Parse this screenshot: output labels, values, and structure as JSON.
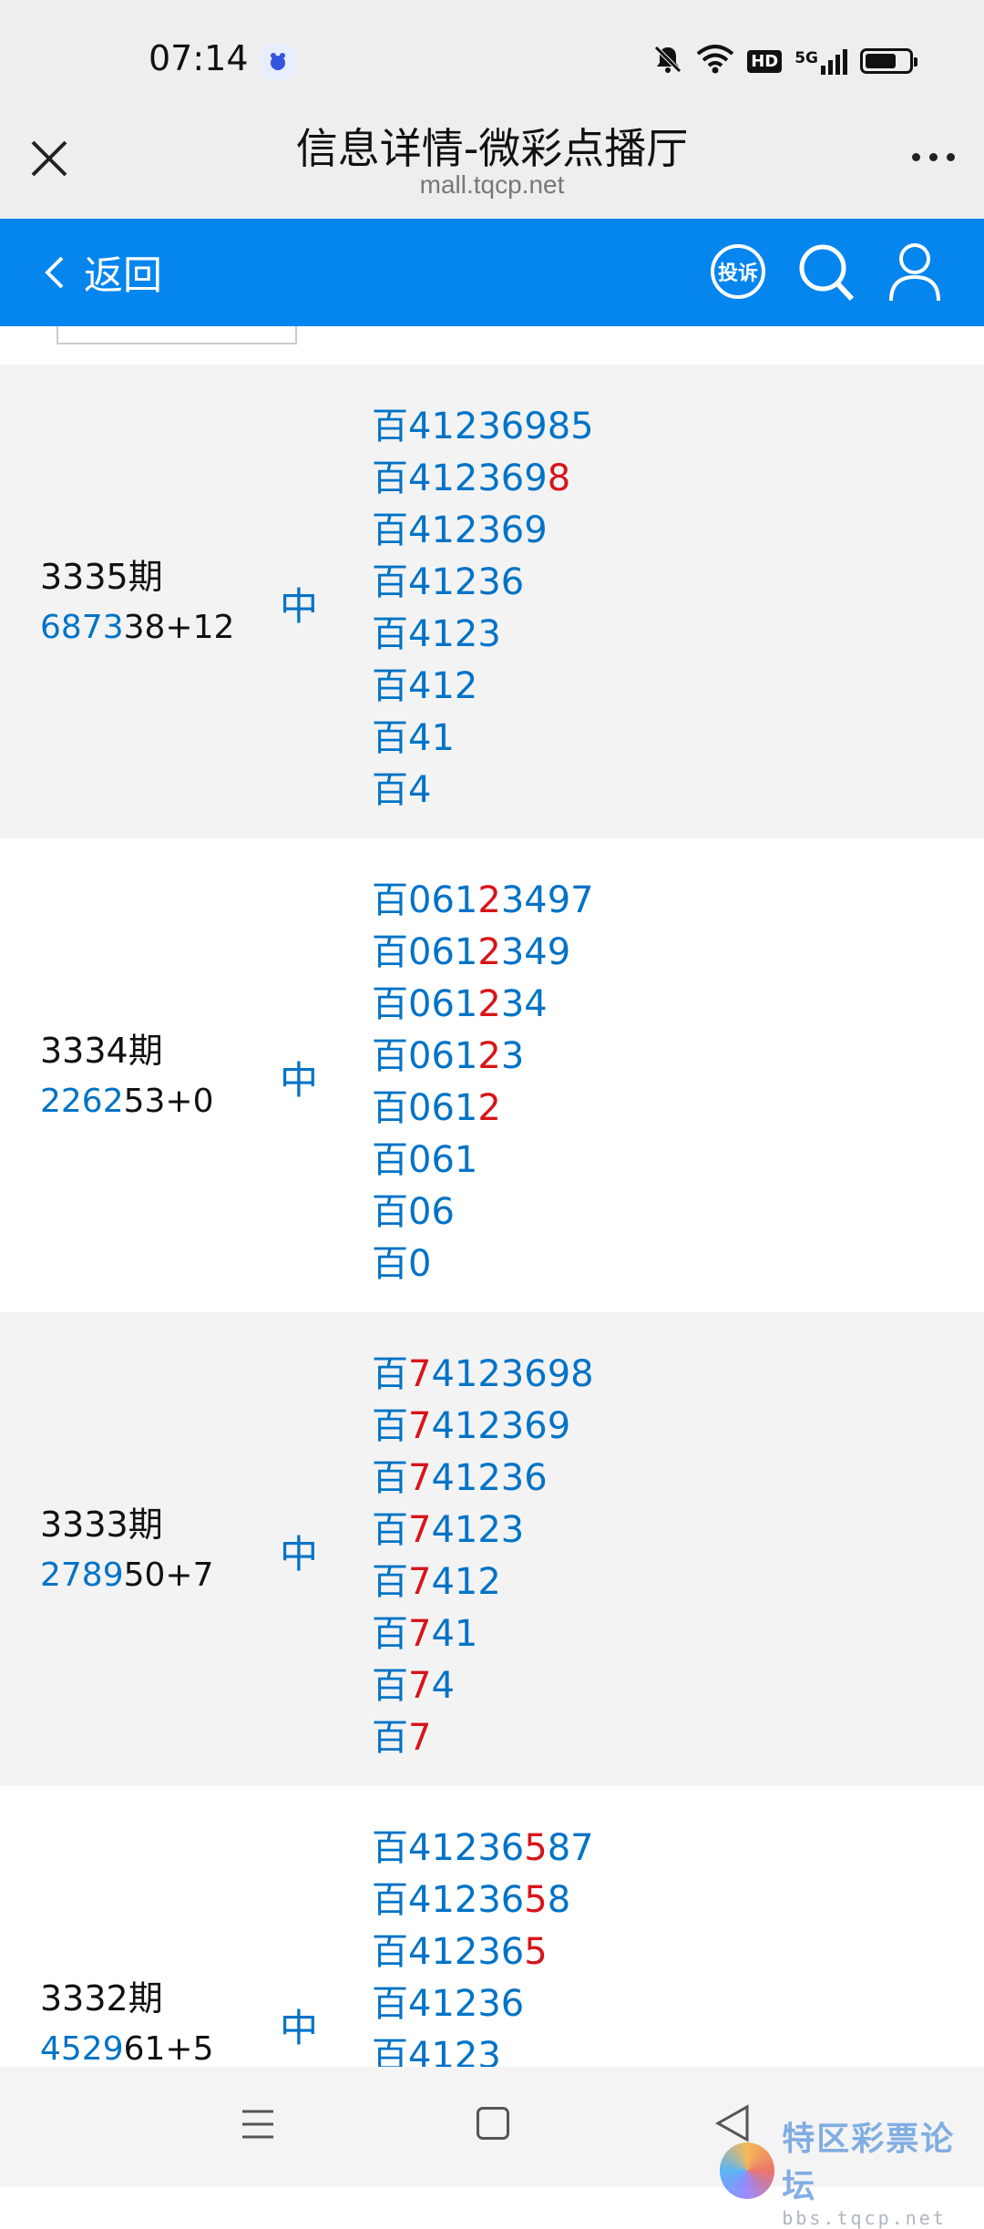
{
  "status_bar": {
    "time": "07:14",
    "icons": [
      "app-icon",
      "mute-icon",
      "wifi-icon",
      "hd-icon",
      "signal-5g-icon",
      "battery-icon"
    ],
    "hd": "HD",
    "network": "5G",
    "battery_level": 0.75
  },
  "title_bar": {
    "title": "信息详情-微彩点播厅",
    "url": "mall.tqcp.net"
  },
  "nav": {
    "back_label": "返回",
    "complaint_label": "投诉",
    "accent": "#0585ee"
  },
  "colors": {
    "number_blue": "#0073c7",
    "highlight_red": "#d7141a"
  },
  "rows": [
    {
      "period": "3335期",
      "draw_highlight": "6873",
      "draw_rest": "38+12",
      "result": "中",
      "predictions": [
        {
          "prefix": "百",
          "a": "4123698",
          "r": "",
          "b": "5"
        },
        {
          "prefix": "百",
          "a": "412369",
          "r": "8",
          "b": ""
        },
        {
          "prefix": "百",
          "a": "412369",
          "r": "",
          "b": ""
        },
        {
          "prefix": "百",
          "a": "41236",
          "r": "",
          "b": ""
        },
        {
          "prefix": "百",
          "a": "4123",
          "r": "",
          "b": ""
        },
        {
          "prefix": "百",
          "a": "412",
          "r": "",
          "b": ""
        },
        {
          "prefix": "百",
          "a": "41",
          "r": "",
          "b": ""
        },
        {
          "prefix": "百",
          "a": "4",
          "r": "",
          "b": ""
        }
      ]
    },
    {
      "period": "3334期",
      "draw_highlight": "2262",
      "draw_rest": "53+0",
      "result": "中",
      "predictions": [
        {
          "prefix": "百",
          "a": "061",
          "r": "2",
          "b": "3497"
        },
        {
          "prefix": "百",
          "a": "061",
          "r": "2",
          "b": "349"
        },
        {
          "prefix": "百",
          "a": "061",
          "r": "2",
          "b": "34"
        },
        {
          "prefix": "百",
          "a": "061",
          "r": "2",
          "b": "3"
        },
        {
          "prefix": "百",
          "a": "061",
          "r": "2",
          "b": ""
        },
        {
          "prefix": "百",
          "a": "061",
          "r": "",
          "b": ""
        },
        {
          "prefix": "百",
          "a": "06",
          "r": "",
          "b": ""
        },
        {
          "prefix": "百",
          "a": "0",
          "r": "",
          "b": ""
        }
      ]
    },
    {
      "period": "3333期",
      "draw_highlight": "2789",
      "draw_rest": "50+7",
      "result": "中",
      "predictions": [
        {
          "prefix": "百",
          "a": "",
          "r": "7",
          "b": "4123698"
        },
        {
          "prefix": "百",
          "a": "",
          "r": "7",
          "b": "412369"
        },
        {
          "prefix": "百",
          "a": "",
          "r": "7",
          "b": "41236"
        },
        {
          "prefix": "百",
          "a": "",
          "r": "7",
          "b": "4123"
        },
        {
          "prefix": "百",
          "a": "",
          "r": "7",
          "b": "412"
        },
        {
          "prefix": "百",
          "a": "",
          "r": "7",
          "b": "41"
        },
        {
          "prefix": "百",
          "a": "",
          "r": "7",
          "b": "4"
        },
        {
          "prefix": "百",
          "a": "",
          "r": "7",
          "b": ""
        }
      ]
    },
    {
      "period": "3332期",
      "draw_highlight": "4529",
      "draw_rest": "61+5",
      "result": "中",
      "predictions": [
        {
          "prefix": "百",
          "a": "41236",
          "r": "5",
          "b": "87"
        },
        {
          "prefix": "百",
          "a": "41236",
          "r": "5",
          "b": "8"
        },
        {
          "prefix": "百",
          "a": "41236",
          "r": "5",
          "b": ""
        },
        {
          "prefix": "百",
          "a": "41236",
          "r": "",
          "b": ""
        },
        {
          "prefix": "百",
          "a": "4123",
          "r": "",
          "b": ""
        }
      ]
    }
  ],
  "watermark": {
    "main": "特区彩票论坛",
    "sub": "bbs.tqcp.net"
  }
}
